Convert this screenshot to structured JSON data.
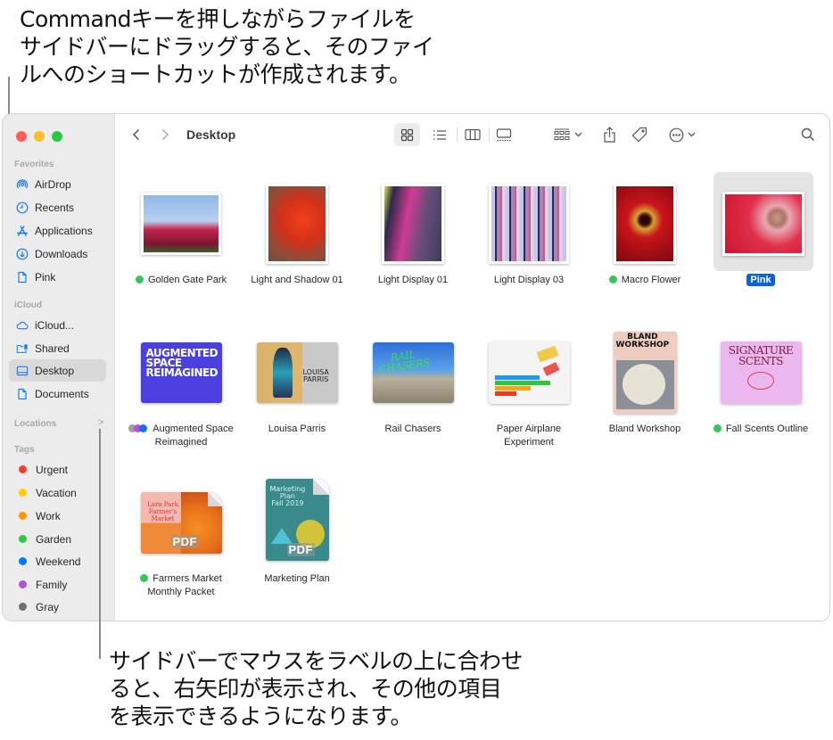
{
  "callouts": {
    "top": [
      "Commandキーを押しながらファイルを",
      "サイドバーにドラッグすると、そのファイ",
      "ルへのショートカットが作成されます。"
    ],
    "bottom": [
      "サイドバーでマウスをラベルの上に合わせ",
      "ると、右矢印が表示され、その他の項目",
      "を表示できるようになります。"
    ]
  },
  "window": {
    "traffic_lights": {
      "close": "#ff5f57",
      "minimize": "#febc2e",
      "zoom": "#28c840"
    },
    "toolbar": {
      "title": "Desktop",
      "back_icon": "chevron-left-icon",
      "forward_icon": "chevron-right-icon",
      "view_modes": [
        "icon-view",
        "list-view",
        "column-view",
        "gallery-view"
      ],
      "active_view": "icon-view",
      "group_icon": "group-by-icon",
      "share_icon": "share-icon",
      "tag_icon": "tag-icon",
      "more_icon": "ellipsis-circle-icon",
      "search_icon": "search-icon"
    },
    "sidebar": {
      "favorites_label": "Favorites",
      "favorites": [
        {
          "label": "AirDrop",
          "icon": "airdrop-icon"
        },
        {
          "label": "Recents",
          "icon": "clock-icon"
        },
        {
          "label": "Applications",
          "icon": "applications-icon"
        },
        {
          "label": "Downloads",
          "icon": "download-icon"
        },
        {
          "label": "Pink",
          "icon": "document-icon"
        }
      ],
      "icloud_label": "iCloud",
      "icloud": [
        {
          "label": "iCloud...",
          "icon": "cloud-icon"
        },
        {
          "label": "Shared",
          "icon": "shared-folder-icon"
        },
        {
          "label": "Desktop",
          "icon": "desktop-icon",
          "active": true
        },
        {
          "label": "Documents",
          "icon": "document-icon"
        }
      ],
      "locations_label": "Locations",
      "locations_chevron": ">",
      "tags_label": "Tags",
      "tags": [
        {
          "label": "Urgent",
          "color": "#ff3b30"
        },
        {
          "label": "Vacation",
          "color": "#ffcc00"
        },
        {
          "label": "Work",
          "color": "#ff9500"
        },
        {
          "label": "Garden",
          "color": "#28cd41"
        },
        {
          "label": "Weekend",
          "color": "#007aff"
        },
        {
          "label": "Family",
          "color": "#af52de"
        },
        {
          "label": "Gray",
          "color": "#8e8e93"
        }
      ]
    },
    "files": [
      {
        "name": "Golden Gate Park",
        "tag": "green"
      },
      {
        "name": "Light and Shadow 01",
        "tag": null
      },
      {
        "name": "Light Display 01",
        "tag": null
      },
      {
        "name": "Light Display 03",
        "tag": null
      },
      {
        "name": "Macro Flower",
        "tag": "green"
      },
      {
        "name": "Pink",
        "tag": null,
        "selected": true
      },
      {
        "name": "Augmented Space Reimagined",
        "tag": "multi",
        "thumb_text": [
          "AUGMENTED",
          "SPACE",
          "REIMAGINED"
        ]
      },
      {
        "name": "Louisa Parris",
        "tag": null,
        "thumb_text": [
          "LOUISA",
          "PARRIS"
        ]
      },
      {
        "name": "Rail Chasers",
        "tag": null,
        "thumb_text": [
          "RAIL",
          "CHASERS"
        ]
      },
      {
        "name": "Paper Airplane Experiment",
        "tag": null
      },
      {
        "name": "Bland Workshop",
        "tag": null,
        "thumb_text": [
          "BLAND",
          "WORKSHOP"
        ]
      },
      {
        "name": "Fall Scents Outline",
        "tag": "green",
        "thumb_text": [
          "SIGNATURE",
          "SCENTS"
        ]
      },
      {
        "name": "Farmers Market Monthly Packet",
        "tag": "green",
        "thumb_text": [
          "Lara Park",
          "Farmer's Market"
        ],
        "badge": "PDF"
      },
      {
        "name": "Marketing Plan",
        "tag": null,
        "thumb_text": [
          "Marketing",
          "Plan",
          "Fall 2019"
        ],
        "badge": "PDF"
      }
    ]
  }
}
